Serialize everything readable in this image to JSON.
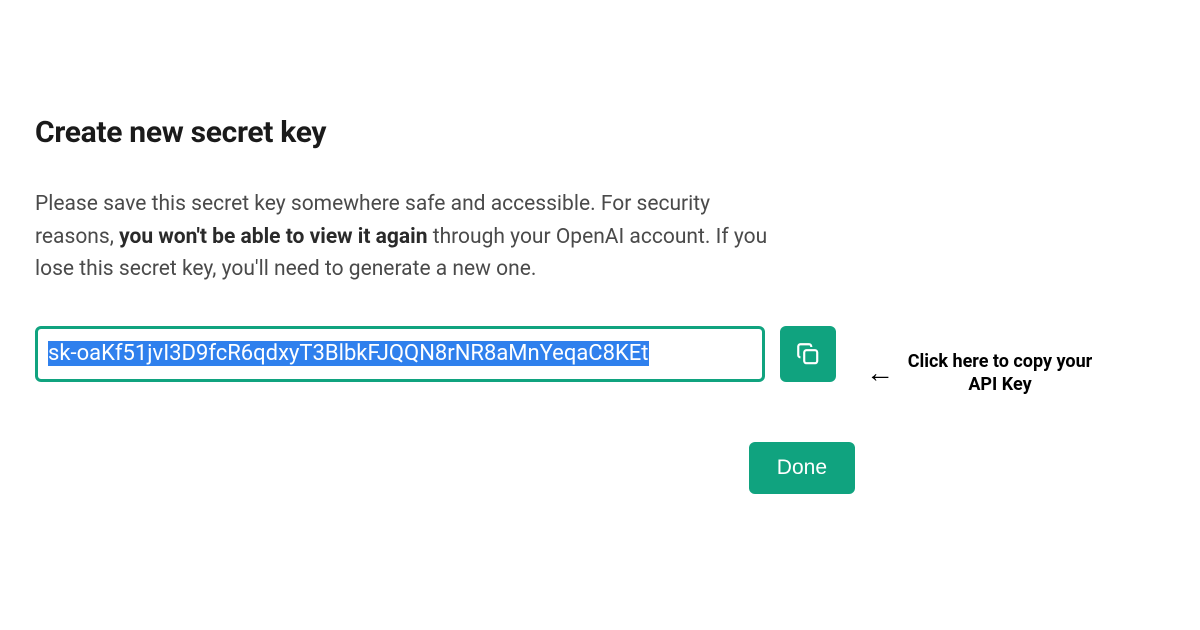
{
  "dialog": {
    "title": "Create new secret key",
    "desc_pre": "Please save this secret key somewhere safe and accessible. For security reasons, ",
    "desc_bold": "you won't be able to view it again",
    "desc_post": " through your OpenAI account. If you lose this secret key, you'll need to generate a new one.",
    "secret_key": "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",
    "done_label": "Done"
  },
  "annotation": {
    "arrow": "←",
    "text": "Click here to copy your API Key"
  },
  "colors": {
    "accent": "#10a37f",
    "selection": "#2f80ed"
  }
}
